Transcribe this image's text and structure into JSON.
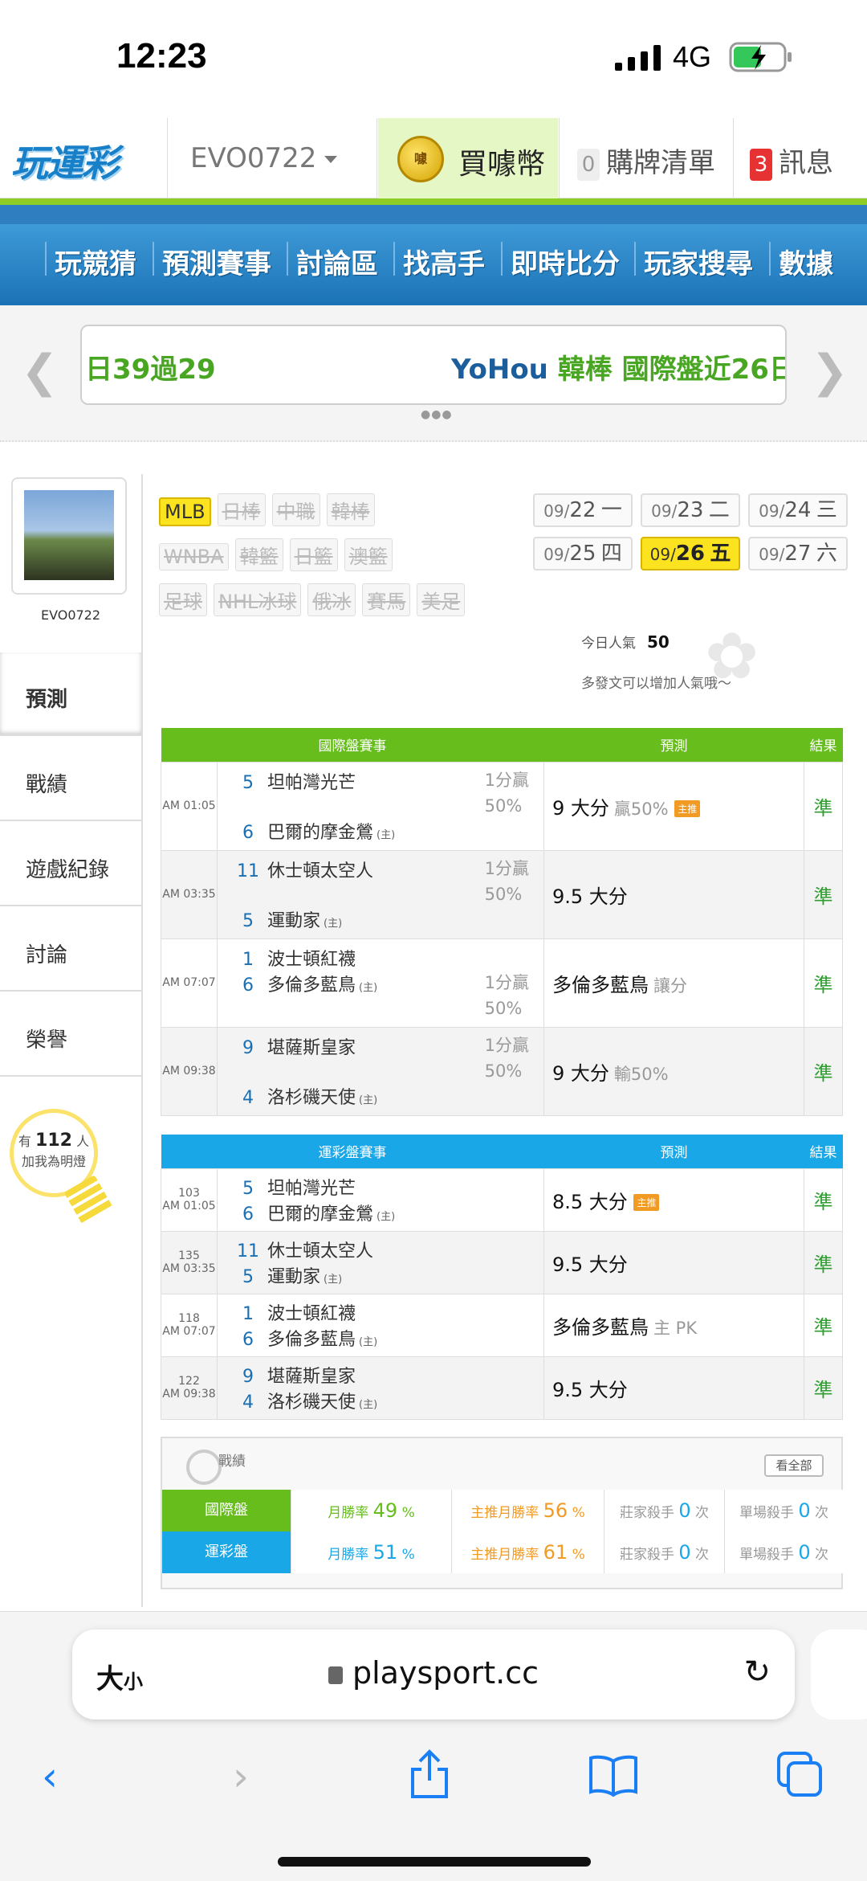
{
  "status": {
    "time": "12:23",
    "network": "4G"
  },
  "topbar": {
    "logo": "玩運彩",
    "user": "EVO0722",
    "buy_coin": "買噱幣",
    "coin_icon_text": "噱",
    "cart_count": "0",
    "cart_label": "購牌清單",
    "msg_count": "3",
    "msg_label": "訊息"
  },
  "nav": [
    "玩競猜",
    "預測賽事",
    "討論區",
    "找高手",
    "即時比分",
    "玩家搜尋",
    "數據"
  ],
  "ticker": {
    "left": "日39過29",
    "right_a": "YoHou",
    "right_b": "韓棒 國際盤近26日"
  },
  "sidebar": {
    "username": "EVO0722",
    "items": [
      "預測",
      "戰績",
      "遊戲紀錄",
      "討論",
      "榮譽"
    ],
    "bulb_prefix": "有",
    "bulb_count": "112",
    "bulb_unit": "人",
    "bulb_text": "加我為明燈"
  },
  "leagues": {
    "row1": [
      "MLB",
      "日棒",
      "中職",
      "韓棒"
    ],
    "row2": [
      "WNBA",
      "韓籃",
      "日籃",
      "澳籃"
    ],
    "row3": [
      "足球",
      "NHL冰球",
      "俄冰",
      "賽馬",
      "美足"
    ],
    "active": "MLB"
  },
  "dates": [
    {
      "md": "09/",
      "d": "22",
      "w": "一"
    },
    {
      "md": "09/",
      "d": "23",
      "w": "二"
    },
    {
      "md": "09/",
      "d": "24",
      "w": "三"
    },
    {
      "md": "09/",
      "d": "25",
      "w": "四"
    },
    {
      "md": "09/",
      "d": "26",
      "w": "五",
      "active": true
    },
    {
      "md": "09/",
      "d": "27",
      "w": "六"
    }
  ],
  "popularity": {
    "label": "今日人氣",
    "value": "50",
    "hint": "多發文可以增加人氣哦～"
  },
  "intl_table": {
    "headers": [
      "國際盤賽事",
      "預測",
      "結果"
    ],
    "rows": [
      {
        "time": "AM 01:05",
        "n1": "5",
        "t1": "坦帕灣光芒",
        "n2": "6",
        "t2": "巴爾的摩金鶯",
        "home": "(主)",
        "odds1": "1分贏",
        "odds2": "50%",
        "pred": "9 大分",
        "sub": "贏50%",
        "badge": "主推",
        "result": "準"
      },
      {
        "time": "AM 03:35",
        "n1": "11",
        "t1": "休士頓太空人",
        "n2": "5",
        "t2": "運動家",
        "home": "(主)",
        "odds1": "1分贏",
        "odds2": "50%",
        "pred": "9.5 大分",
        "sub": "",
        "badge": "",
        "result": "準"
      },
      {
        "time": "AM 07:07",
        "n1": "1",
        "t1": "波士頓紅襪",
        "n2": "6",
        "t2": "多倫多藍鳥",
        "home": "(主)",
        "odds1": "1分贏",
        "odds2": "50%",
        "pred": "多倫多藍鳥",
        "sub": "讓分",
        "badge": "",
        "result": "準"
      },
      {
        "time": "AM 09:38",
        "n1": "9",
        "t1": "堪薩斯皇家",
        "n2": "4",
        "t2": "洛杉磯天使",
        "home": "(主)",
        "odds1": "1分贏",
        "odds2": "50%",
        "pred": "9 大分",
        "sub": "輸50%",
        "badge": "",
        "result": "準"
      }
    ]
  },
  "lottery_table": {
    "headers": [
      "運彩盤賽事",
      "預測",
      "結果"
    ],
    "rows": [
      {
        "code": "103",
        "time": "AM 01:05",
        "n1": "5",
        "t1": "坦帕灣光芒",
        "n2": "6",
        "t2": "巴爾的摩金鶯",
        "home": "(主)",
        "pred": "8.5 大分",
        "sub": "",
        "badge": "主推",
        "result": "準"
      },
      {
        "code": "135",
        "time": "AM 03:35",
        "n1": "11",
        "t1": "休士頓太空人",
        "n2": "5",
        "t2": "運動家",
        "home": "(主)",
        "pred": "9.5 大分",
        "sub": "",
        "badge": "",
        "result": "準"
      },
      {
        "code": "118",
        "time": "AM 07:07",
        "n1": "1",
        "t1": "波士頓紅襪",
        "n2": "6",
        "t2": "多倫多藍鳥",
        "home": "(主)",
        "pred": "多倫多藍鳥",
        "sub": "主 PK",
        "badge": "",
        "result": "準"
      },
      {
        "code": "122",
        "time": "AM 09:38",
        "n1": "9",
        "t1": "堪薩斯皇家",
        "n2": "4",
        "t2": "洛杉磯天使",
        "home": "(主)",
        "pred": "9.5 大分",
        "sub": "",
        "badge": "",
        "result": "準"
      }
    ]
  },
  "stats": {
    "title": "戰績",
    "view_all": "看全部",
    "rows": [
      {
        "label": "國際盤",
        "c1": "月勝率",
        "v1": "49",
        "c2": "主推月勝率",
        "v2": "56",
        "c3": "莊家殺手",
        "v3": "0",
        "c4": "單場殺手",
        "v4": "0",
        "pct": "%",
        "unit": "次"
      },
      {
        "label": "運彩盤",
        "c1": "月勝率",
        "v1": "51",
        "c2": "主推月勝率",
        "v2": "61",
        "c3": "莊家殺手",
        "v3": "0",
        "c4": "單場殺手",
        "v4": "0",
        "pct": "%",
        "unit": "次"
      }
    ],
    "colors": {
      "intl": "#66bd1c",
      "lottery": "#1aa7e8",
      "win": "#66bd1c",
      "main": "#f19b24",
      "count": "#1aa7e8"
    }
  },
  "safari": {
    "text_size_a": "大",
    "text_size_b": "小",
    "url": "playsport.cc"
  }
}
